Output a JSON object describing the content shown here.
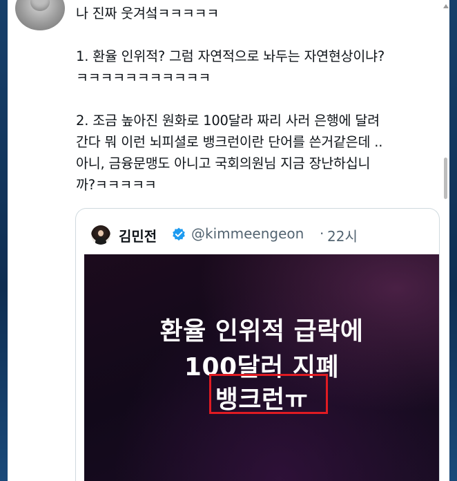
{
  "tweet": {
    "text": "나 진짜 웃겨섴ㅋㅋㅋㅋㅋ\n\n1. 환율 인위적? 그럼 자연적으로 놔두는 자연현상이냐?\nㅋㅋㅋㅋㅋㅋㅋㅋㅋㅋㅋ\n\n2. 조금 높아진 원화로 100달라 짜리 사러 은행에 달려\n간다 뭐 이런 뇌피셜로 뱅크런이란 단어를 쓴거같은데 ..\n아니, 금융문맹도 아니고 국회의원님 지금 장난하십니\n까?ㅋㅋㅋㅋㅋ"
  },
  "quote": {
    "name": "김민전",
    "handle": "@kimmeengeon",
    "separator": "·",
    "time": "22시",
    "image_lines": [
      "환율 인위적 급락에",
      "100달러 지폐",
      "뱅크런ㅠ"
    ]
  },
  "colors": {
    "verified": "#1d9bf0",
    "highlight_border": "#e01b22",
    "text_primary": "#0f1419",
    "text_secondary": "#536471"
  },
  "icons": {
    "verified": "verified-badge-icon",
    "scroll_up": "chevron-up-icon"
  }
}
